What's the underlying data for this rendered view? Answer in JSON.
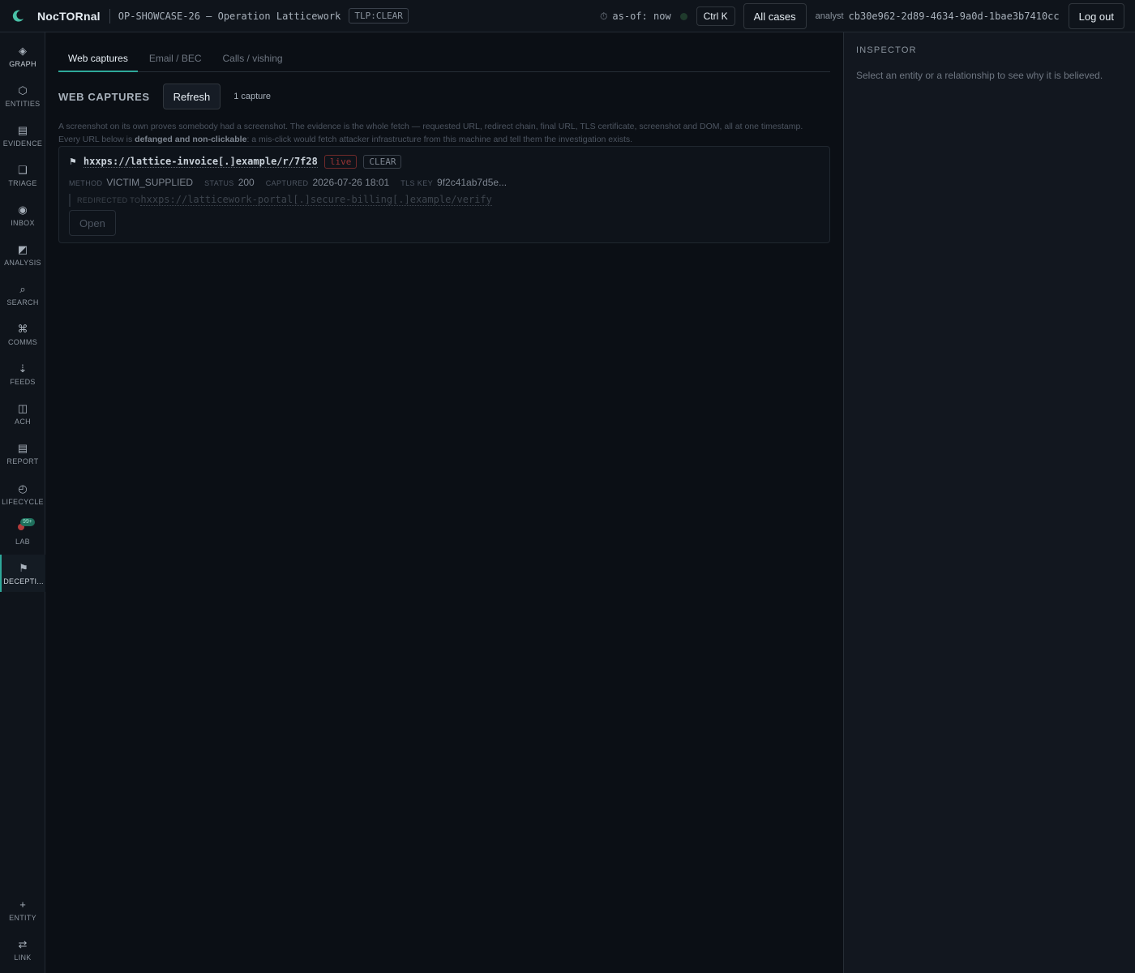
{
  "app": {
    "brand": "NocTORnal",
    "case_title": "OP-SHOWCASE-26 — Operation Latticework",
    "tlp": "TLP:CLEAR"
  },
  "header": {
    "asof": "as-of: now",
    "shortcut": "Ctrl K",
    "all_cases": "All cases",
    "analyst_label": "analyst",
    "analyst_id": "cb30e962-2d89-4634-9a0d-1bae3b7410cc",
    "logout": "Log out"
  },
  "rail": {
    "items": [
      {
        "label": "GRAPH",
        "icon": "◈"
      },
      {
        "label": "ENTITIES",
        "icon": "⬡"
      },
      {
        "label": "EVIDENCE",
        "icon": "▤"
      },
      {
        "label": "TRIAGE",
        "icon": "❑"
      },
      {
        "label": "INBOX",
        "icon": "◉"
      },
      {
        "label": "ANALYSIS",
        "icon": "◩"
      },
      {
        "label": "SEARCH",
        "icon": "⌕"
      },
      {
        "label": "COMMS",
        "icon": "⌘"
      },
      {
        "label": "FEEDS",
        "icon": "⇣"
      },
      {
        "label": "ACH",
        "icon": "◫"
      },
      {
        "label": "REPORT",
        "icon": "▤"
      },
      {
        "label": "LIFECYCLE",
        "icon": "◴"
      },
      {
        "label": "LAB",
        "icon": "",
        "badge": "99+"
      },
      {
        "label": "DECEPTI...",
        "icon": "⚑"
      }
    ],
    "bottom": [
      {
        "label": "ENTITY",
        "icon": "+"
      },
      {
        "label": "LINK",
        "icon": "⇄"
      }
    ]
  },
  "main": {
    "tabs": [
      "Web captures",
      "Email / BEC",
      "Calls / vishing"
    ],
    "section_title": "WEB CAPTURES",
    "refresh": "Refresh",
    "count": "1 capture",
    "help_line1": "A screenshot on its own proves somebody had a screenshot. The evidence is the whole fetch — requested URL, redirect chain, final URL, TLS certificate, screenshot and DOM, all at one timestamp.",
    "help_line2_pre": "Every URL below is ",
    "help_line2_bold": "defanged and non-clickable",
    "help_line2_post": ": a mis-click would fetch attacker infrastructure from this machine and tell them the investigation exists.",
    "capture": {
      "url": "hxxps://lattice-invoice[.]example/r/7f28",
      "live_badge": "live",
      "tlp_badge": "CLEAR",
      "method_label": "METHOD",
      "method": "VICTIM_SUPPLIED",
      "status_label": "STATUS",
      "status": "200",
      "captured_label": "CAPTURED",
      "captured": "2026-07-26 18:01",
      "tls_label": "TLS KEY",
      "tls": "9f2c41ab7d5e...",
      "redirect_label": "REDIRECTED TO",
      "redirect_url": "hxxps://latticework-portal[.]secure-billing[.]example/verify",
      "open": "Open"
    }
  },
  "inspector": {
    "title": "INSPECTOR",
    "body": "Select an entity or a relationship to see why it is believed."
  },
  "colors": {
    "accent": "#2ea89a",
    "background": "#0b0f15",
    "live": "#9a3535"
  }
}
